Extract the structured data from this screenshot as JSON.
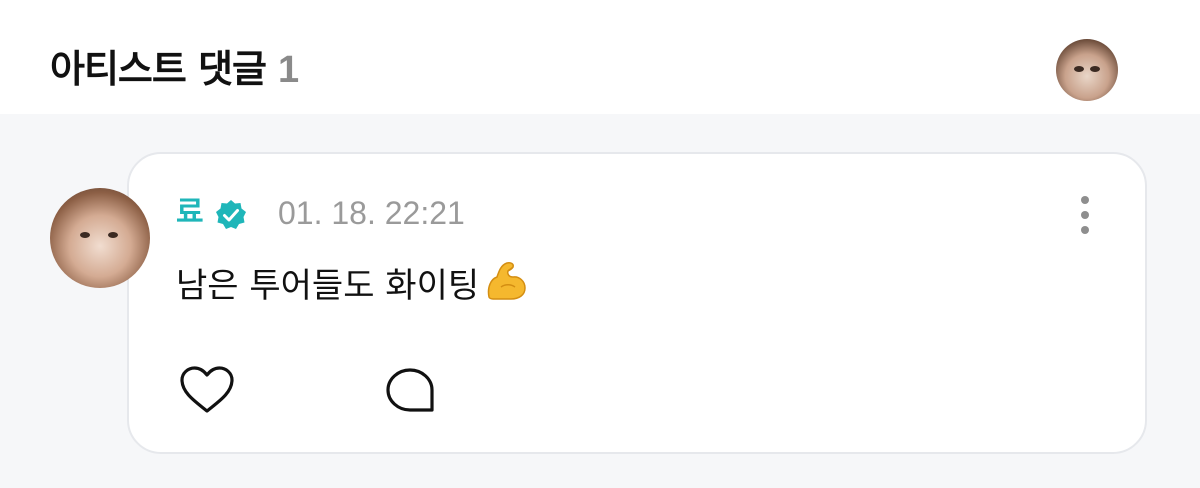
{
  "header": {
    "title": "아티스트 댓글",
    "count": "1",
    "avatar_icon": "profile-avatar"
  },
  "comment": {
    "author": "료",
    "verified_icon": "verified-badge-icon",
    "timestamp": "01. 18. 22:21",
    "text": "남은 투어들도 화이팅",
    "emoji": "flexed-biceps",
    "actions": {
      "like_icon": "heart-icon",
      "reply_icon": "speech-bubble-icon",
      "more_icon": "more-vertical-icon"
    }
  },
  "colors": {
    "accent": "#1fb6b9",
    "background": "#f6f7f9",
    "card": "#ffffff",
    "muted_text": "#9a9a9a"
  }
}
